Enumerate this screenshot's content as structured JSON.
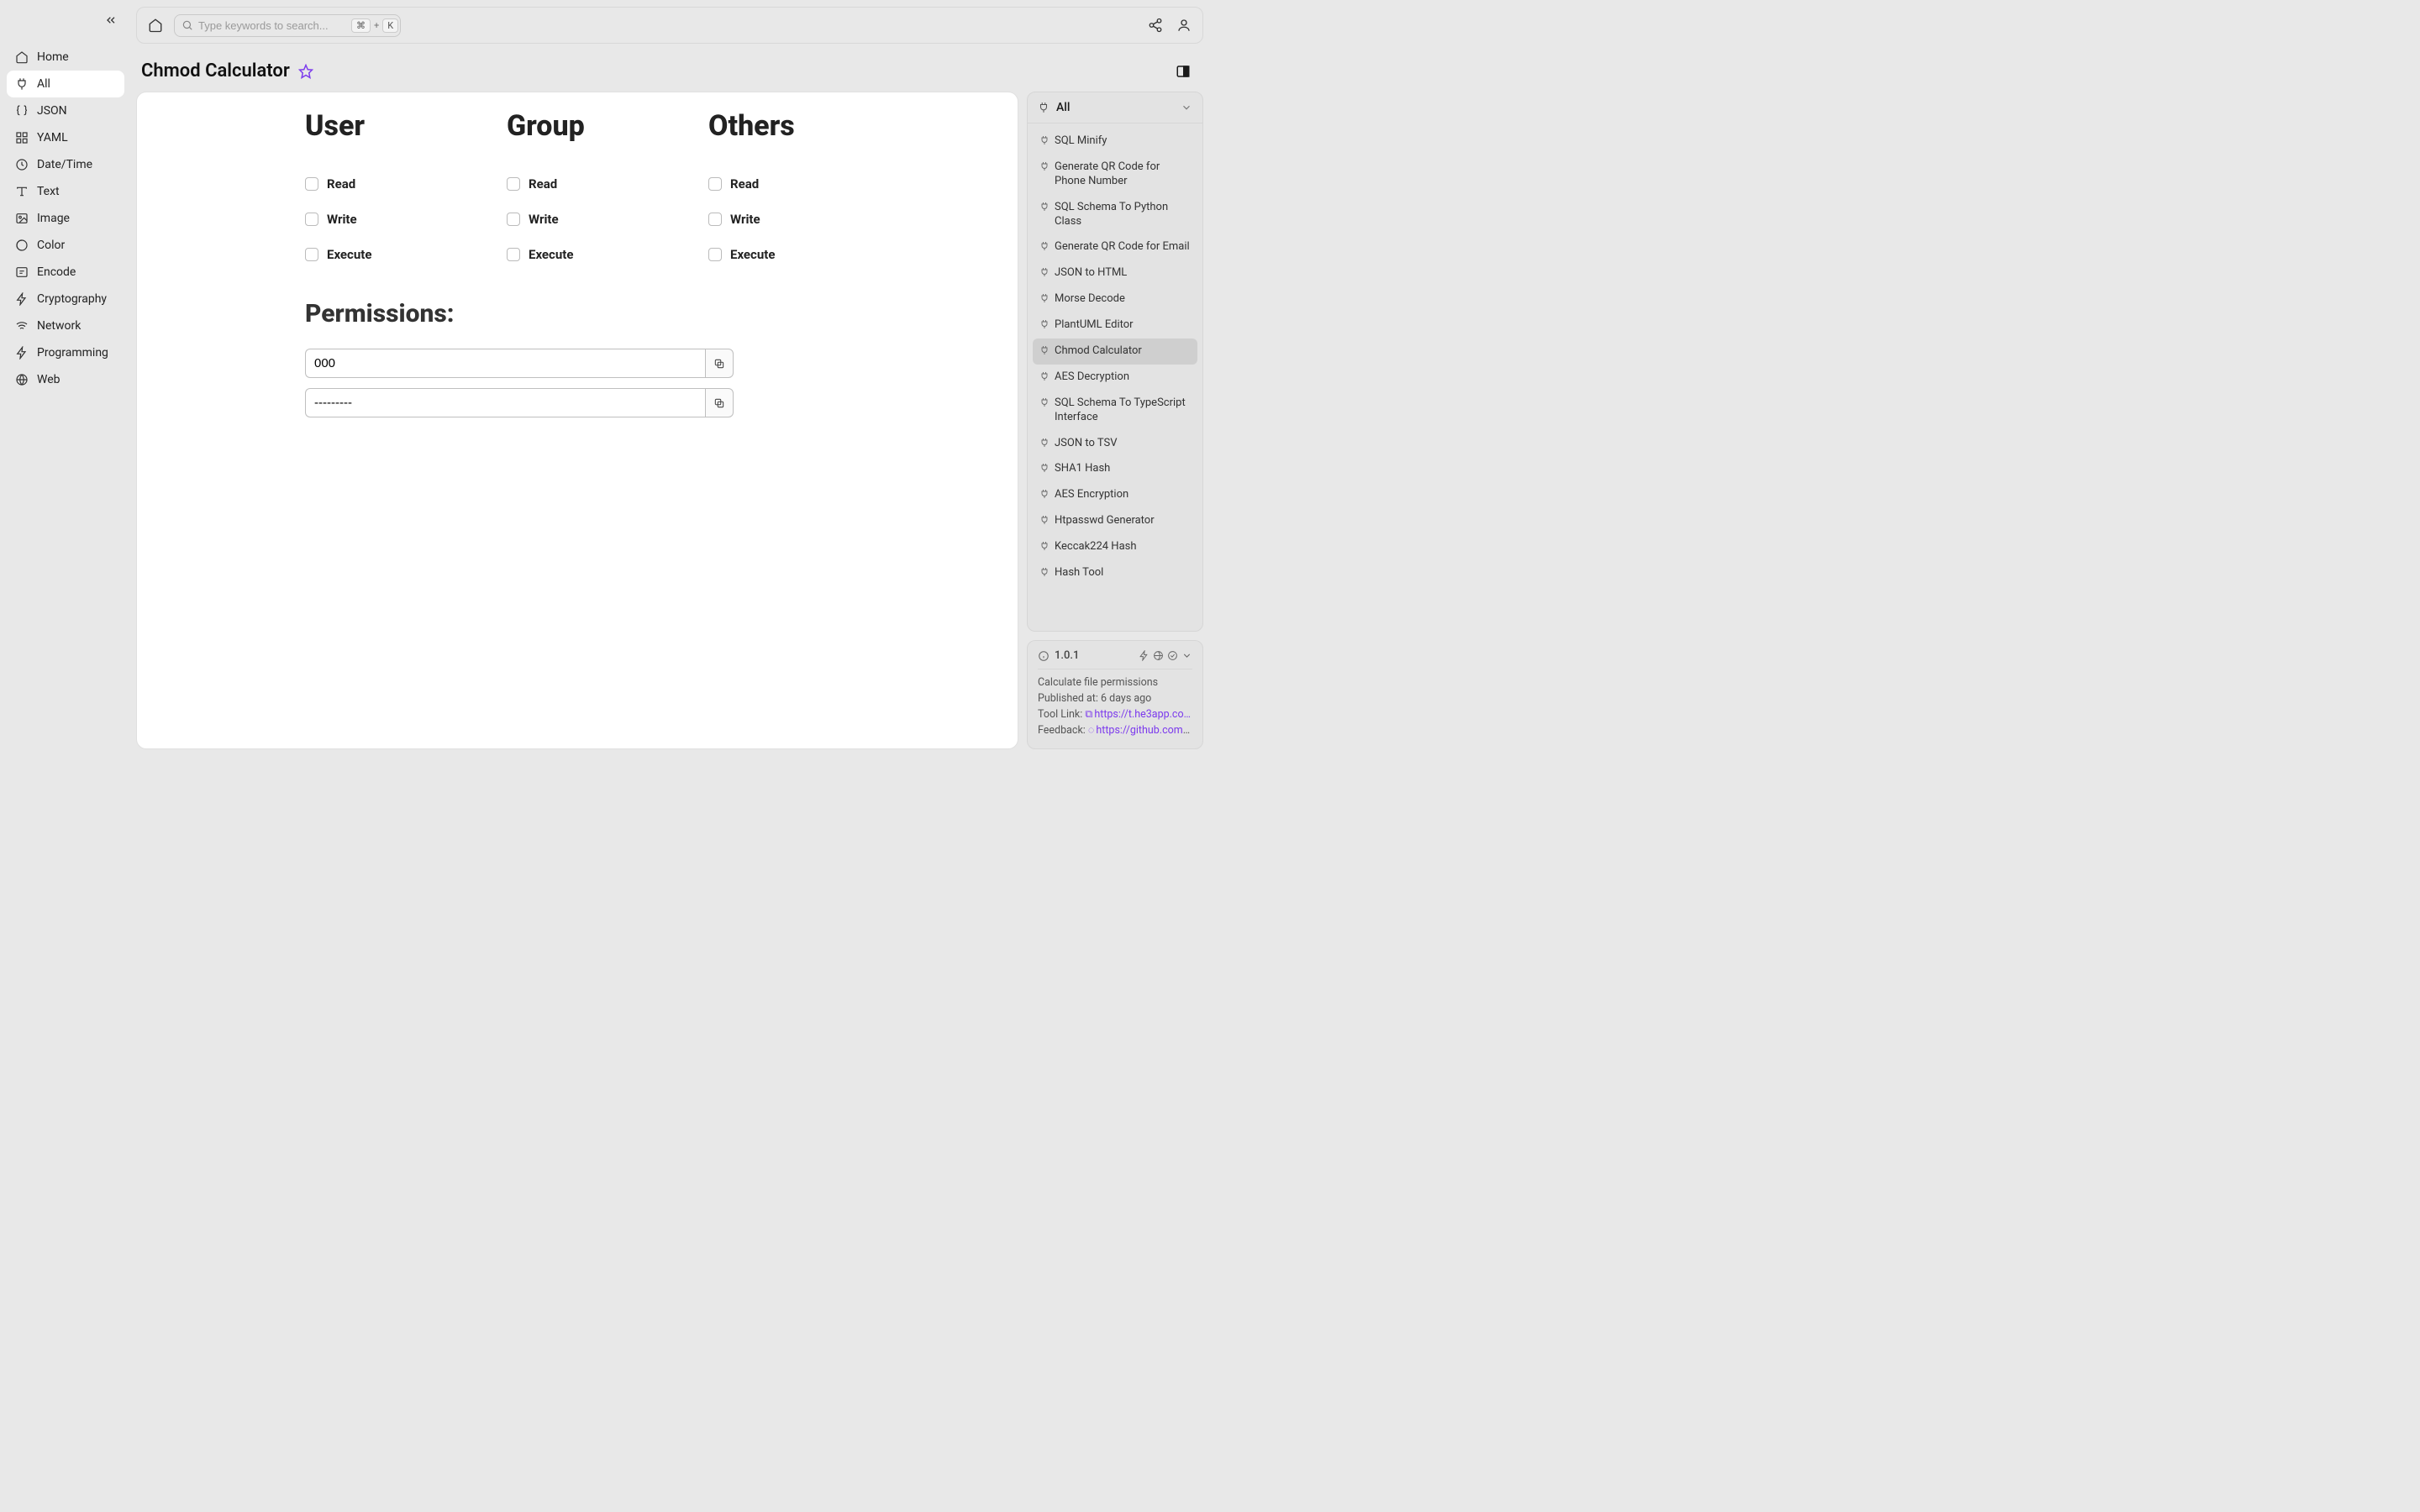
{
  "search": {
    "placeholder": "Type keywords to search...",
    "shortcut_mod": "⌘",
    "shortcut_plus": "+",
    "shortcut_key": "K"
  },
  "sidebar": {
    "items": [
      {
        "label": "Home"
      },
      {
        "label": "All"
      },
      {
        "label": "JSON"
      },
      {
        "label": "YAML"
      },
      {
        "label": "Date/Time"
      },
      {
        "label": "Text"
      },
      {
        "label": "Image"
      },
      {
        "label": "Color"
      },
      {
        "label": "Encode"
      },
      {
        "label": "Cryptography"
      },
      {
        "label": "Network"
      },
      {
        "label": "Programming"
      },
      {
        "label": "Web"
      }
    ]
  },
  "page": {
    "title": "Chmod Calculator"
  },
  "perm": {
    "user_h": "User",
    "group_h": "Group",
    "others_h": "Others",
    "read": "Read",
    "write": "Write",
    "execute": "Execute",
    "permissions_h": "Permissions:",
    "octal": "000",
    "symbolic": "---------"
  },
  "right": {
    "category": "All",
    "tools": [
      "SQL Minify",
      "Generate QR Code for Phone Number",
      "SQL Schema To Python Class",
      "Generate QR Code for Email",
      "JSON to HTML",
      "Morse Decode",
      "PlantUML Editor",
      "Chmod Calculator",
      "AES Decryption",
      "SQL Schema To TypeScript Interface",
      "JSON to TSV",
      "SHA1 Hash",
      "AES Encryption",
      "Htpasswd Generator",
      "Keccak224 Hash",
      "Hash Tool"
    ],
    "active_index": 7
  },
  "info": {
    "version": "1.0.1",
    "desc": "Calculate file permissions",
    "published_label": "Published at:",
    "published_value": "6 days ago",
    "tool_link_label": "Tool Link:",
    "tool_link_url": "https://t.he3app.co…",
    "feedback_label": "Feedback:",
    "feedback_url": "https://github.com/…"
  }
}
